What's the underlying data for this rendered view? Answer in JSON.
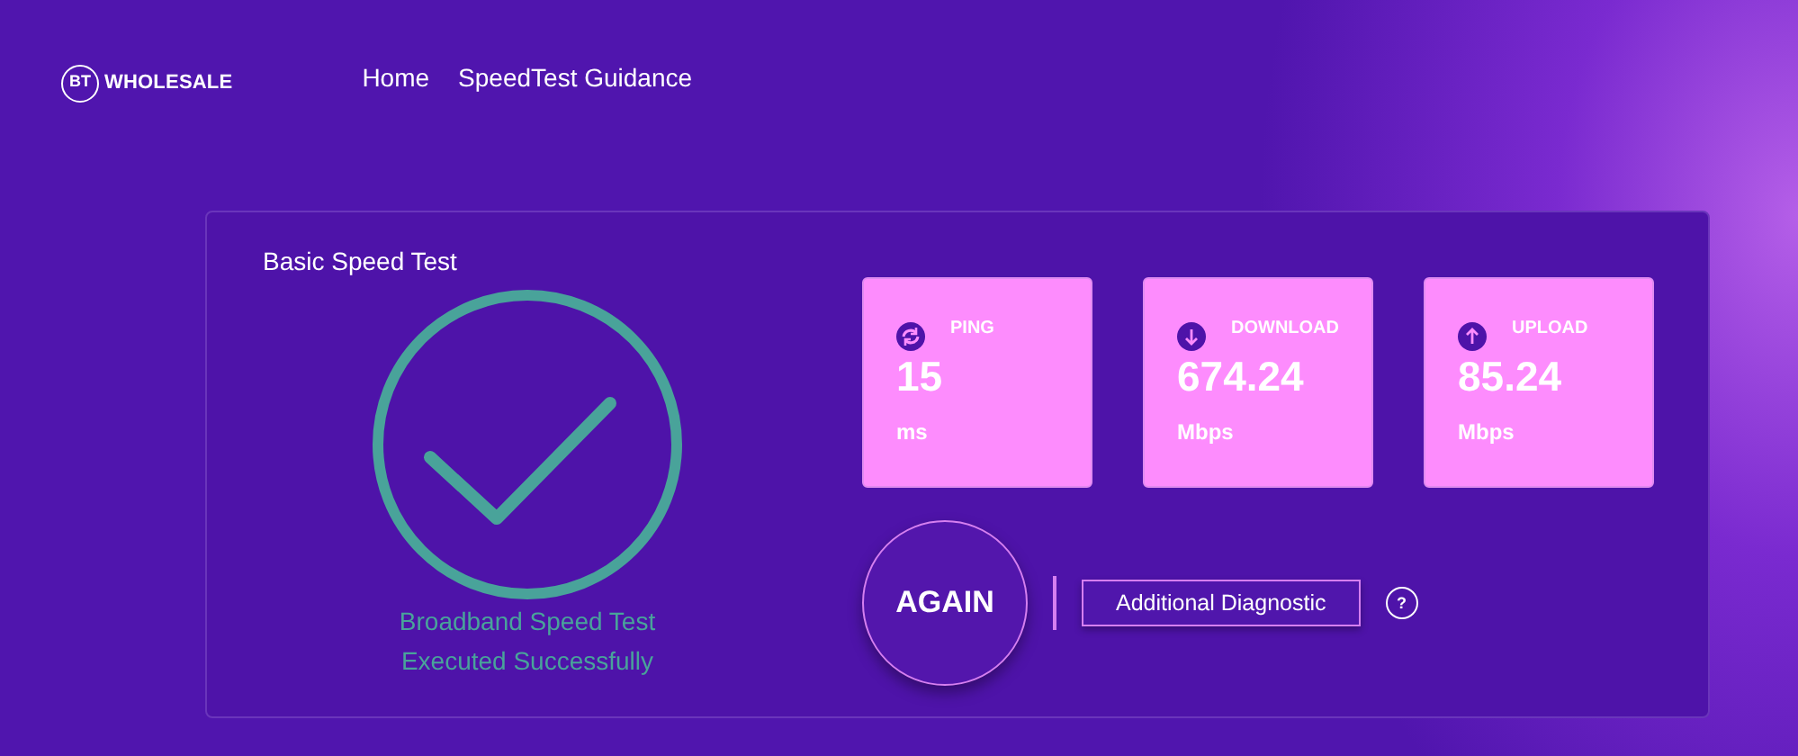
{
  "logo": {
    "badge": "BT",
    "text": "WHOLESALE"
  },
  "nav": [
    "Home",
    "SpeedTest Guidance"
  ],
  "panel": {
    "title": "Basic Speed Test",
    "completed": true,
    "message": [
      "Broadband Speed Test",
      "Executed Successfully"
    ],
    "metrics": [
      {
        "kind": "ping",
        "label": "PING",
        "value": "15",
        "unit": "ms"
      },
      {
        "kind": "download",
        "label": "DOWNLOAD",
        "value": "674.24",
        "unit": "Mbps"
      },
      {
        "kind": "upload",
        "label": "UPLOAD",
        "value": "85.24",
        "unit": "Mbps"
      }
    ],
    "again_button": "AGAIN",
    "diagnostic_button": "Additional Diagnostic",
    "help": "?"
  }
}
